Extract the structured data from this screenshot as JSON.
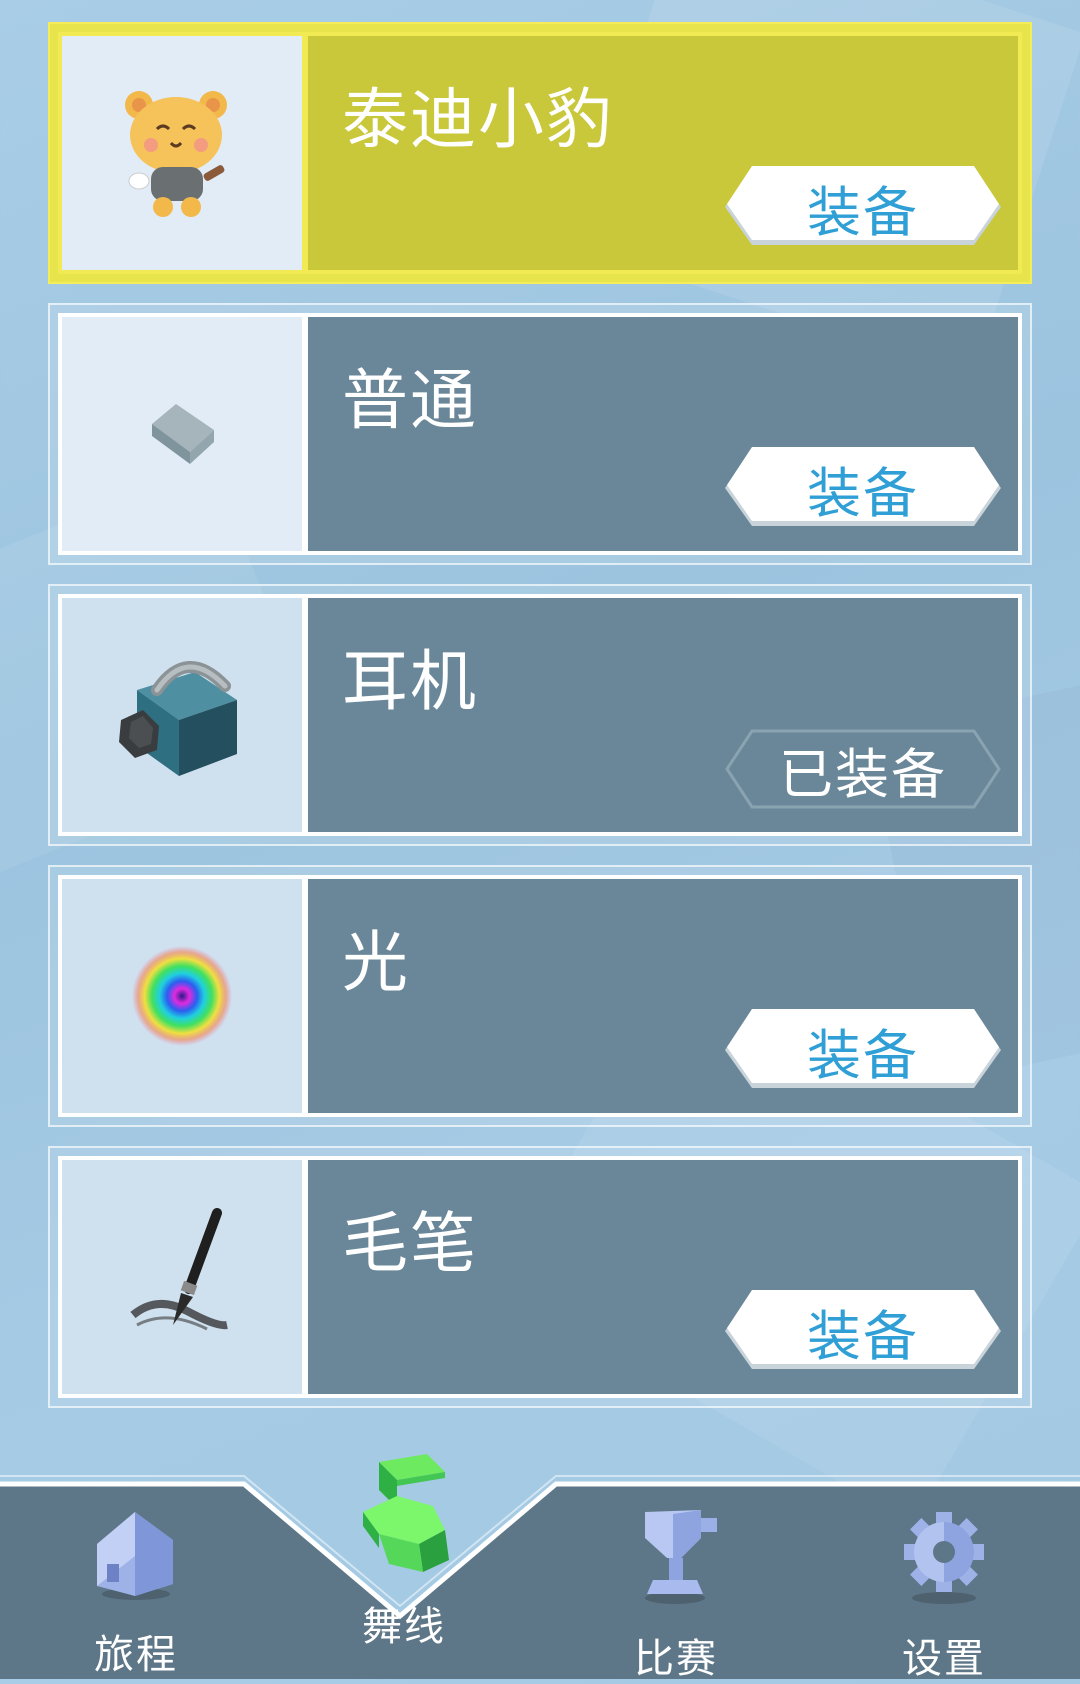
{
  "items": [
    {
      "name": "泰迪小豹",
      "button": "装备",
      "state": "selected",
      "icon": "teddy-leopard-icon"
    },
    {
      "name": "普通",
      "button": "装备",
      "state": "normal",
      "icon": "gray-block-icon"
    },
    {
      "name": "耳机",
      "button": "已装备",
      "state": "equipped",
      "icon": "headphone-cube-icon"
    },
    {
      "name": "光",
      "button": "装备",
      "state": "normal",
      "icon": "rainbow-light-icon"
    },
    {
      "name": "毛笔",
      "button": "装备",
      "state": "normal",
      "icon": "brush-icon"
    }
  ],
  "nav": {
    "journey": "旅程",
    "dance_line": "舞线",
    "match": "比赛",
    "settings": "设置",
    "active": "dance_line"
  },
  "colors": {
    "selected_panel": "#c9c73a",
    "normal_panel": "#6a8799",
    "button_text": "#2f9fd6",
    "nav_bg": "#5e7788"
  }
}
